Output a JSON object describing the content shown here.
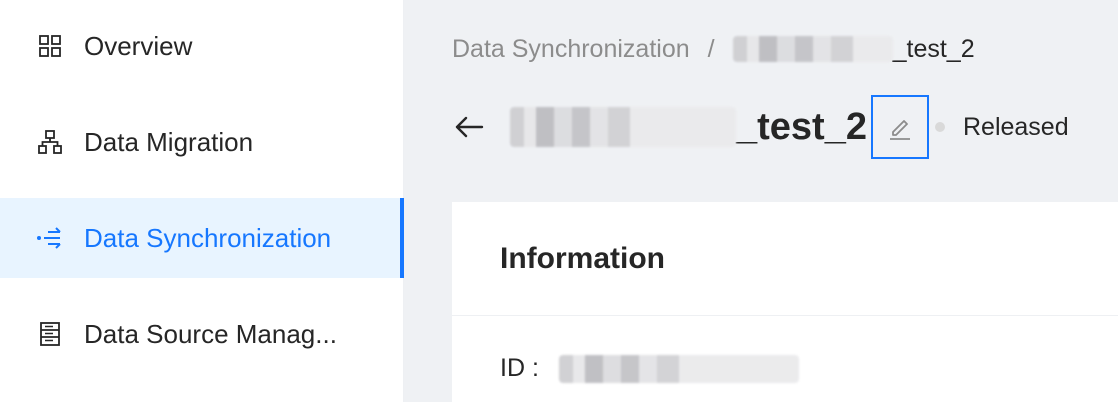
{
  "sidebar": {
    "items": [
      {
        "label": "Overview",
        "icon": "grid-icon",
        "active": false
      },
      {
        "label": "Data Migration",
        "icon": "sitemap-icon",
        "active": false
      },
      {
        "label": "Data Synchronization",
        "icon": "sync-icon",
        "active": true
      },
      {
        "label": "Data Source Manag...",
        "icon": "database-icon",
        "active": false
      }
    ]
  },
  "breadcrumb": {
    "parent": "Data Synchronization",
    "separator": "/",
    "current_suffix": "_test_2"
  },
  "header": {
    "title_suffix": "_test_2",
    "status": "Released"
  },
  "card": {
    "title": "Information",
    "id_label": "ID :"
  },
  "colors": {
    "accent": "#1677ff",
    "active_bg": "#e8f4ff",
    "main_bg": "#eff1f4",
    "status_dot": "#d9d9d9"
  }
}
